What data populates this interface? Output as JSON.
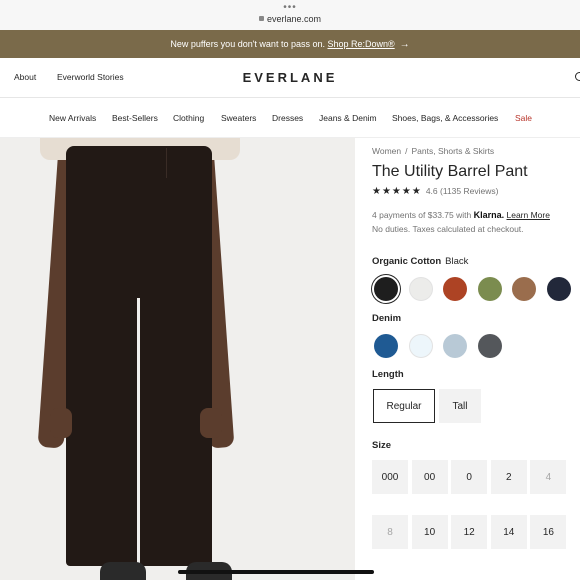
{
  "browser": {
    "url": "everlane.com"
  },
  "promo": {
    "text": "New puffers you don't want to pass on.",
    "link": "Shop Re:Down®"
  },
  "topnav": {
    "about": "About",
    "stories": "Everworld Stories",
    "brand": "EVERLANE"
  },
  "categories": [
    "New Arrivals",
    "Best-Sellers",
    "Clothing",
    "Sweaters",
    "Dresses",
    "Jeans & Denim",
    "Shoes, Bags, & Accessories",
    "Sale"
  ],
  "product": {
    "breadcrumb": [
      "Women",
      "Pants, Shorts & Skirts"
    ],
    "title": "The Utility Barrel Pant",
    "rating": {
      "stars": "★★★★★",
      "value": "4.6",
      "reviews": "(1135 Reviews)"
    },
    "klarna": {
      "prefix": "4 payments of $33.75 with",
      "brand": "Klarna.",
      "link": "Learn More"
    },
    "duties": "No duties. Taxes calculated at checkout.",
    "cotton": {
      "label": "Organic Cotton",
      "selected": "Black",
      "colors": [
        "#1e1e1e",
        "#ececea",
        "#ad4324",
        "#7b8c4f",
        "#9a6d4d",
        "#22283a"
      ]
    },
    "denim": {
      "label": "Denim",
      "colors": [
        "#1f5a93",
        "#edf6fb",
        "#b8c9d6",
        "#54575b"
      ]
    },
    "length": {
      "label": "Length",
      "options": [
        "Regular",
        "Tall"
      ],
      "selected": "Regular"
    },
    "size": {
      "label": "Size",
      "options": [
        "000",
        "00",
        "0",
        "2",
        "4",
        "8",
        "10",
        "12",
        "14",
        "16"
      ],
      "unavailable": [
        "4",
        "8"
      ]
    }
  },
  "colors": {
    "promo_bg": "#7a6a4a",
    "sale": "#b8352b",
    "text": "#262626"
  }
}
